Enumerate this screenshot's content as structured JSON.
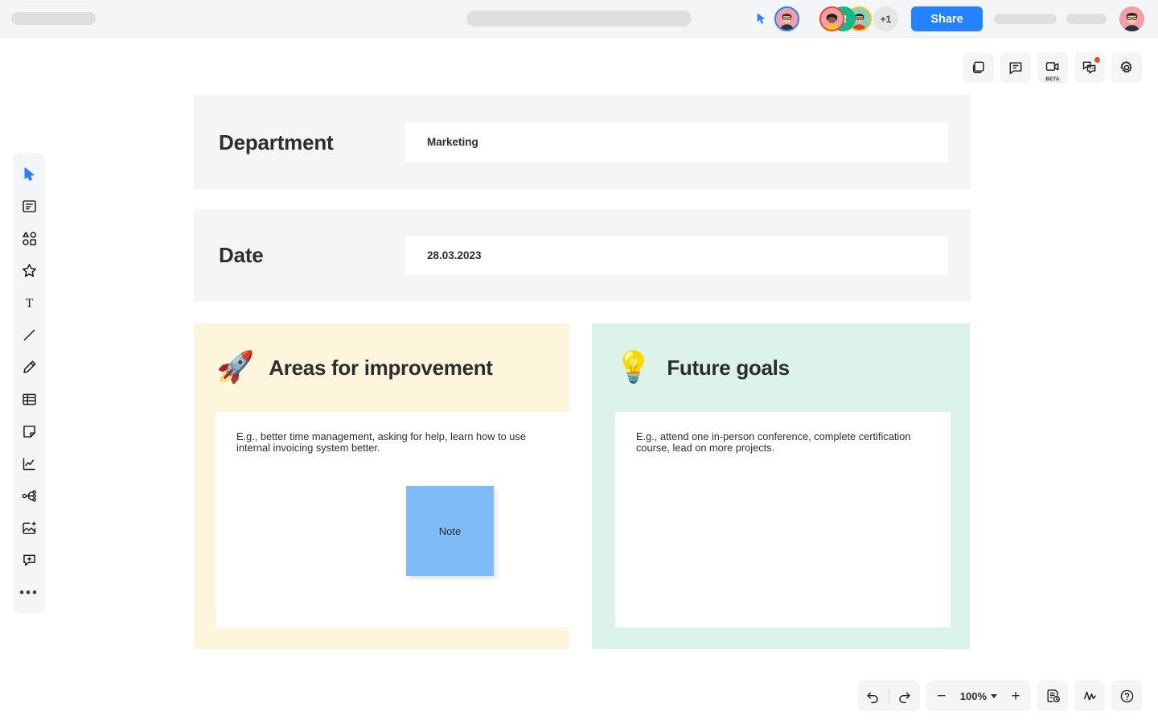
{
  "topbar": {
    "cursor_icon": "cursor-pointer-icon",
    "share_label": "Share",
    "collaborators": [
      {
        "name": "avatar-user-1",
        "type": "photo",
        "ring": "#2681ff"
      },
      {
        "name": "avatar-user-2",
        "type": "photo",
        "ring": "#f24726"
      },
      {
        "name": "avatar-user-3",
        "type": "initial",
        "initial": "R",
        "bg": "#12b886"
      },
      {
        "name": "avatar-user-4",
        "type": "photo",
        "ring": "#fac710"
      }
    ],
    "overflow_count": "+1",
    "profile_avatar": "avatar-profile"
  },
  "top_tools": [
    {
      "name": "frames-icon",
      "label": "Frames"
    },
    {
      "name": "comment-icon",
      "label": "Comments"
    },
    {
      "name": "video-chat-icon",
      "label": "Video chat",
      "badge": "BETA"
    },
    {
      "name": "chat-icon",
      "label": "Chat",
      "notification": true
    },
    {
      "name": "gear-icon",
      "label": "Settings"
    }
  ],
  "left_toolbar": [
    {
      "name": "select-tool",
      "label": "Select",
      "active": true
    },
    {
      "name": "template-tool",
      "label": "Templates",
      "active": false
    },
    {
      "name": "shapes-tool",
      "label": "Shapes",
      "active": false
    },
    {
      "name": "sticker-tool",
      "label": "Stickers",
      "active": false
    },
    {
      "name": "text-tool",
      "label": "Text",
      "active": false
    },
    {
      "name": "line-tool",
      "label": "Line",
      "active": false
    },
    {
      "name": "pen-tool",
      "label": "Pen",
      "active": false
    },
    {
      "name": "table-tool",
      "label": "Table",
      "active": false
    },
    {
      "name": "sticky-note-tool",
      "label": "Sticky note",
      "active": false
    },
    {
      "name": "chart-tool",
      "label": "Chart",
      "active": false
    },
    {
      "name": "mindmap-tool",
      "label": "Mind map",
      "active": false
    },
    {
      "name": "image-tool",
      "label": "Upload image",
      "active": false
    },
    {
      "name": "comment-tool",
      "label": "Add comment",
      "active": false
    },
    {
      "name": "more-tool",
      "label": "More",
      "active": false
    }
  ],
  "board": {
    "rows": [
      {
        "label": "Department",
        "value": "Marketing"
      },
      {
        "label": "Date",
        "value": "28.03.2023"
      }
    ],
    "cards": [
      {
        "emoji": "🚀",
        "emoji_name": "rocket-emoji",
        "title": "Areas for improvement",
        "hint": "E.g., better time management, asking for help, learn how to use internal invoicing system better.",
        "color": "#fdf5dc"
      },
      {
        "emoji": "💡",
        "emoji_name": "lightbulb-emoji",
        "title": "Future goals",
        "hint": "E.g., attend one in-person conference, complete certification course, lead on more projects.",
        "color": "#dbf3e8"
      }
    ],
    "sticky_note": {
      "text": "Note",
      "color": "#7fbbf7"
    }
  },
  "bottom_bar": {
    "undo": "undo-icon",
    "redo": "redo-icon",
    "zoom_out": "−",
    "zoom_level": "100%",
    "zoom_in": "+",
    "history": "history-icon",
    "activity": "activity-icon",
    "help": "?"
  },
  "colors": {
    "accent": "#2681ff",
    "panel": "#f4f5f7",
    "skeleton": "#dedfe1",
    "notification": "#f24726"
  }
}
